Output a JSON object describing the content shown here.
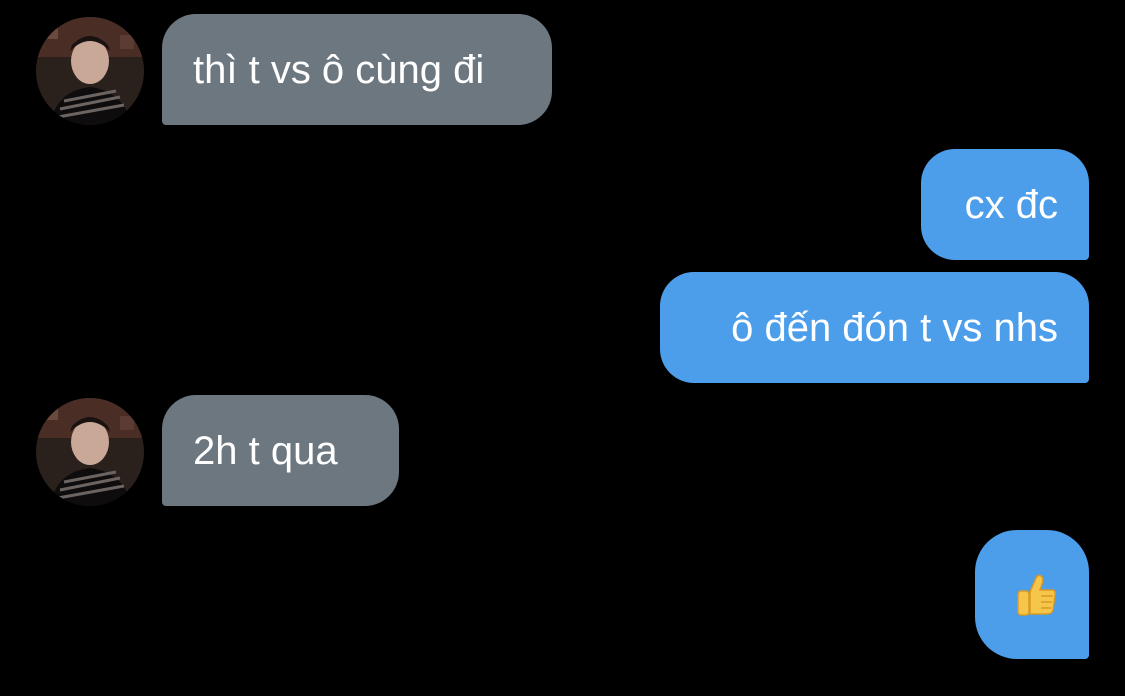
{
  "conversation": {
    "messages": [
      {
        "direction": "incoming",
        "text": "thì t vs ô cùng đi",
        "has_avatar": true
      },
      {
        "direction": "outgoing",
        "text": "cx đc"
      },
      {
        "direction": "outgoing",
        "text": "ô đến đón t vs nhs"
      },
      {
        "direction": "incoming",
        "text": "2h t qua",
        "has_avatar": true
      },
      {
        "direction": "outgoing",
        "emoji": "thumbs-up-icon"
      }
    ]
  },
  "colors": {
    "background": "#000000",
    "incoming_bubble": "#6d7780",
    "outgoing_bubble": "#4c9eea",
    "text": "#ffffff"
  }
}
